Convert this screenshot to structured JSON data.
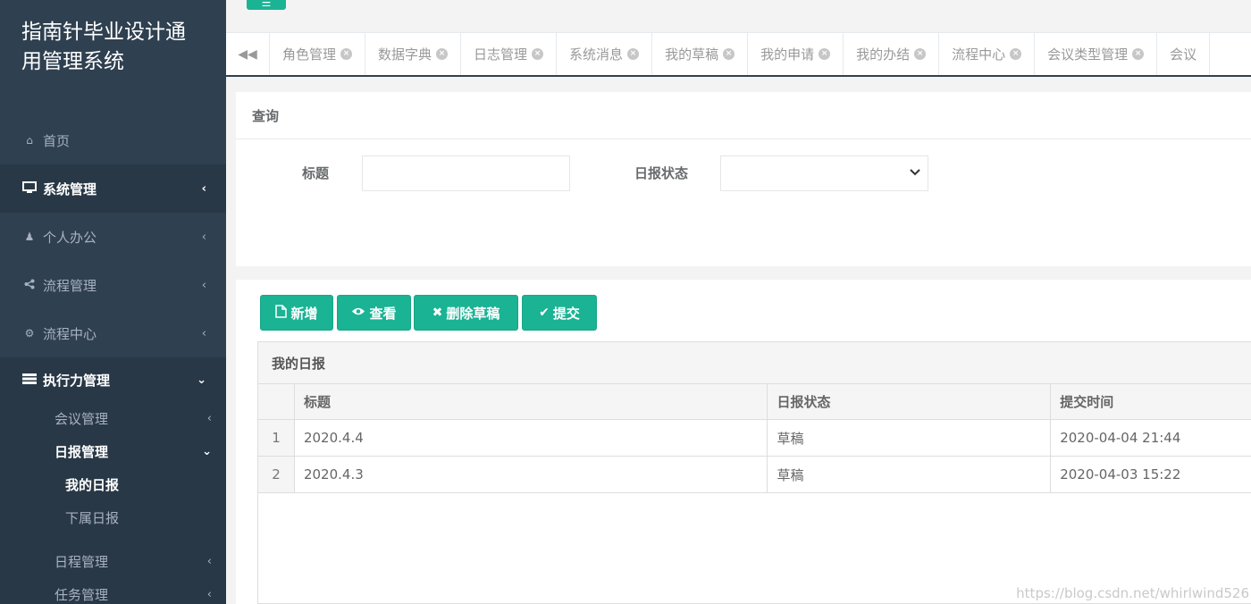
{
  "app": {
    "title": "指南针毕业设计通用管理系统"
  },
  "sidebar": {
    "items": [
      {
        "label": "首页",
        "icon": "home-icon"
      },
      {
        "label": "系统管理",
        "icon": "desktop-icon"
      },
      {
        "label": "个人办公",
        "icon": "user-icon"
      },
      {
        "label": "流程管理",
        "icon": "share-icon"
      },
      {
        "label": "流程中心",
        "icon": "gear-icon"
      },
      {
        "label": "执行力管理",
        "icon": "list-icon"
      }
    ],
    "sub": {
      "meeting": "会议管理",
      "daily": "日报管理",
      "my_daily": "我的日报",
      "sub_daily": "下属日报",
      "schedule": "日程管理",
      "task": "任务管理"
    }
  },
  "tabs": [
    "角色管理",
    "数据字典",
    "日志管理",
    "系统消息",
    "我的草稿",
    "我的申请",
    "我的办结",
    "流程中心",
    "会议类型管理",
    "会议"
  ],
  "query": {
    "title": "查询",
    "title_label": "标题",
    "status_label": "日报状态",
    "title_value": "",
    "status_value": ""
  },
  "toolbar": {
    "add": "新增",
    "view": "查看",
    "delete": "删除草稿",
    "submit": "提交"
  },
  "grid": {
    "title": "我的日报",
    "headers": [
      "标题",
      "日报状态",
      "提交时间"
    ],
    "rows": [
      {
        "no": "1",
        "title": "2020.4.4",
        "status": "草稿",
        "time": "2020-04-04 21:44"
      },
      {
        "no": "2",
        "title": "2020.4.3",
        "status": "草稿",
        "time": "2020-04-03 15:22"
      }
    ]
  },
  "watermark": "https://blog.csdn.net/whirlwind526",
  "colors": {
    "sidebar": "#2f4050",
    "accent": "#1ab394"
  }
}
